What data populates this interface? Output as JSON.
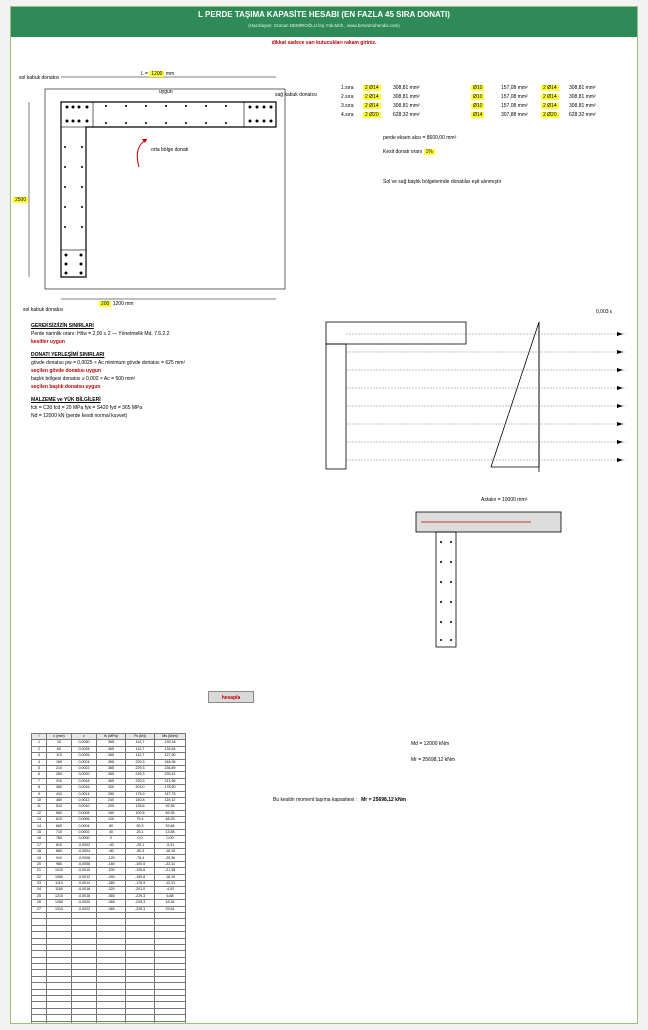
{
  "header": {
    "title": "L PERDE TAŞIMA KAPASİTE HESABI (EN FAZLA 45 SIRA DONATI)",
    "subtitle": "(Hazırlayan: Gürcan DEMİROĞLU İnş.Yük.Müh., www.betonmuhendis.com)",
    "instruction": "dikkat sadece sarı kutucukları rakam giriniz."
  },
  "colors": {
    "title_bar": "#2e8b57",
    "input": "#ffff33",
    "warning": "#c00000",
    "rebar": "#000000"
  },
  "section": {
    "top_width_label": "L =",
    "top_width": "1200",
    "unit": "mm",
    "height_label": "h =",
    "height": "250",
    "total_height": "2500",
    "left_labels": [
      "sol kabuk donatısı",
      "sol kabuk donatısı"
    ],
    "right_label": "sağ kabuk donatısı",
    "mid_label": "orta bölge donatı",
    "bottom_labels": [
      "200",
      "1200",
      "mm"
    ],
    "ok_text": "uygun"
  },
  "rows": [
    {
      "n": "1.sıra",
      "a": "2 Ø14",
      "b": "308,81 mm²",
      "c": "Ø10",
      "d": "157,08 mm²",
      "e": "2 Ø14",
      "f": "308,81 mm²"
    },
    {
      "n": "2.sıra",
      "a": "2 Ø14",
      "b": "308,81 mm²",
      "c": "Ø10",
      "d": "157,08 mm²",
      "e": "2 Ø14",
      "f": "308,81 mm²"
    },
    {
      "n": "3.sıra",
      "a": "2 Ø14",
      "b": "308,81 mm²",
      "c": "Ø10",
      "d": "157,08 mm²",
      "e": "2 Ø14",
      "f": "308,81 mm²"
    },
    {
      "n": "4.sıra",
      "a": "2 Ø20",
      "b": "628,32 mm²",
      "c": "Ø14",
      "d": "307,88 mm²",
      "e": "2 Ø20",
      "f": "628,32 mm²"
    }
  ],
  "right_summary": {
    "perde_label": "perde eksen aksı =",
    "perde_val": "8600,00 mm²",
    "ak_label": "Kesit donatı oranı",
    "ak_val": "1%",
    "note": "Sol ve sağ başlık bölgelerinde donatılar eşit alınmıştır"
  },
  "text_blocks": [
    {
      "type": "hdr",
      "text": "GEREKSİZ/İZİN SINIRLARI"
    },
    {
      "type": "line",
      "text": "Perde narinlik oranı: H/lw = 2,00 ≤ 2  — Yönetmelik Md. 7.6.2.2"
    },
    {
      "type": "red",
      "text": "kesitler uygun"
    },
    {
      "type": "hdr",
      "text": "DONATI YERLEŞİMİ SINIRLARI"
    },
    {
      "type": "line",
      "text": "gövde donatısı pw = 0,0025 × Ac   minimum gövde donatısı = 625 mm²"
    },
    {
      "type": "red",
      "text": "seçilen gövde donatısı uygun"
    },
    {
      "type": "line",
      "text": "başlık bölgesi donatısı ≥ 0,002 × Ac  = 500 mm²"
    },
    {
      "type": "red",
      "text": "seçilen başlık donatısı uygun"
    },
    {
      "type": "hdr",
      "text": "MALZEME ve YÜK BİLGİLERİ"
    },
    {
      "type": "line",
      "text": "fck = C30   fcd = 20 MPa   fyk = S420   fyd = 365 MPa"
    },
    {
      "type": "line",
      "text": "Nd = 12000 kN  (perde kesiti normal kuvvet)"
    }
  ],
  "button": {
    "label": "hesapla"
  },
  "right_results": {
    "line1": "Md = 12000 kNm",
    "line2": "Mr = 25698,12 kNm",
    "result_label": "Bu kesitin moment taşıma kapasitesi :",
    "result_val": "Mr = 25698,12 kNm"
  },
  "right_diagram": {
    "label1": "Astalın = 10000 mm²",
    "label2": "0,003 ε",
    "label3": "fyd"
  },
  "table": {
    "headers": [
      "i",
      "c (mm)",
      "ε",
      "fs (MPa)",
      "Fs (kN)",
      "Ms (kNm)"
    ],
    "rows": [
      [
        "1",
        "10",
        "0,0030",
        "365",
        "112,7",
        "139,18"
      ],
      [
        "2",
        "60",
        "0,0028",
        "365",
        "112,7",
        "133,54"
      ],
      [
        "3",
        "110",
        "0,0026",
        "365",
        "112,7",
        "127,90"
      ],
      [
        "4",
        "160",
        "0,0024",
        "365",
        "229,3",
        "248,36"
      ],
      [
        "5",
        "210",
        "0,0022",
        "365",
        "229,3",
        "236,89"
      ],
      [
        "6",
        "260",
        "0,0020",
        "365",
        "229,3",
        "225,42"
      ],
      [
        "7",
        "310",
        "0,0018",
        "365",
        "229,3",
        "213,96"
      ],
      [
        "8",
        "360",
        "0,0016",
        "320",
        "201,0",
        "178,90"
      ],
      [
        "9",
        "410",
        "0,0014",
        "280",
        "175,9",
        "147,75"
      ],
      [
        "10",
        "460",
        "0,0012",
        "240",
        "150,8",
        "119,12"
      ],
      [
        "11",
        "510",
        "0,0010",
        "200",
        "125,6",
        "92,95"
      ],
      [
        "12",
        "560",
        "0,0008",
        "160",
        "100,5",
        "69,35"
      ],
      [
        "13",
        "610",
        "0,0006",
        "120",
        "75,4",
        "48,25"
      ],
      [
        "14",
        "660",
        "0,0004",
        "80",
        "50,3",
        "29,66"
      ],
      [
        "15",
        "710",
        "0,0002",
        "40",
        "25,1",
        "13,58"
      ],
      [
        "16",
        "760",
        "0,0000",
        "0",
        "0,0",
        "0,00"
      ],
      [
        "17",
        "810",
        "-0,0002",
        "-40",
        "-25,1",
        "-9,31"
      ],
      [
        "18",
        "860",
        "-0,0004",
        "-80",
        "-50,3",
        "-16,10"
      ],
      [
        "19",
        "910",
        "-0,0006",
        "-120",
        "-75,4",
        "-20,36"
      ],
      [
        "20",
        "960",
        "-0,0008",
        "-160",
        "-100,5",
        "-22,11"
      ],
      [
        "21",
        "1010",
        "-0,0010",
        "-200",
        "-125,6",
        "-21,35"
      ],
      [
        "22",
        "1060",
        "-0,0012",
        "-240",
        "-150,8",
        "-18,10"
      ],
      [
        "23",
        "1110",
        "-0,0014",
        "-280",
        "-175,9",
        "-12,31"
      ],
      [
        "24",
        "1160",
        "-0,0016",
        "-320",
        "-201,0",
        "-4,02"
      ],
      [
        "25",
        "1210",
        "-0,0018",
        "-365",
        "-229,3",
        "6,88"
      ],
      [
        "26",
        "1260",
        "-0,0020",
        "-365",
        "-229,3",
        "18,34"
      ],
      [
        "27",
        "1310",
        "-0,0022",
        "-365",
        "-229,3",
        "29,81"
      ]
    ],
    "footer": [
      "Toplam",
      "",
      "",
      "",
      "3412,8",
      "25698,12"
    ]
  }
}
